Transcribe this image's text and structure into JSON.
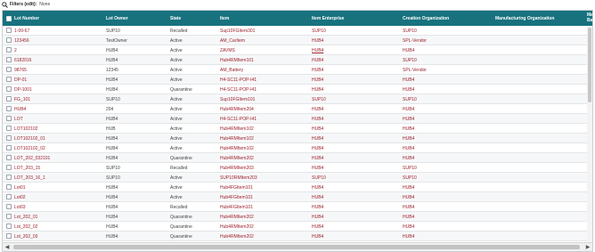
{
  "filters": {
    "label": "Filters (edit):",
    "value": "None"
  },
  "table": {
    "columns": [
      "Lot Number",
      "Lot Owner",
      "State",
      "Item",
      "Item Enterprise",
      "Creation Organization",
      "Manufacturing Organization",
      "Ma Ba"
    ],
    "rows": [
      [
        "1-09-67",
        "SUP10",
        "Recalled",
        "Sup10FGItem301",
        "SUP10",
        "SUP10"
      ],
      [
        "123456",
        "TestOwner",
        "Active",
        "AM_CarItem",
        "HUB4",
        "SPL-Vendor"
      ],
      [
        "2",
        "HUB4",
        "Active",
        "ZAVMS",
        "HUB4",
        "HUB4"
      ],
      [
        "6182016",
        "HUB4",
        "Active",
        "Hub4RMItem101",
        "HUB4",
        "SUP10"
      ],
      [
        "98765",
        "12345",
        "Active",
        "AM_Battery",
        "HUB4",
        "SPL-Vendor"
      ],
      [
        "DP-01",
        "HUB4",
        "Active",
        "H4-SC11-POP-I41",
        "HUB4",
        "HUB4"
      ],
      [
        "DP-1001",
        "HUB4",
        "Quarantine",
        "H4-SC11-POP-I41",
        "HUB4",
        "HUB4"
      ],
      [
        "FG_101",
        "SUP10",
        "Active",
        "Sup10FGItem101",
        "SUP10",
        "SUP10"
      ],
      [
        "HUB4",
        "204",
        "Active",
        "Hub4RMItem204",
        "HUB4",
        "HUB4"
      ],
      [
        "LOT",
        "HUB4",
        "Active",
        "H4-SC11-POP-I41",
        "HUB4",
        "HUB4"
      ],
      [
        "LOT102102",
        "HUB",
        "Active",
        "Hub4RMItem102",
        "HUB4",
        "HUB4"
      ],
      [
        "LOT102102_01",
        "HUB4",
        "Active",
        "Hub4RMItem102",
        "HUB4",
        "HUB4"
      ],
      [
        "LOT102102_02",
        "HUB4",
        "Active",
        "Hub4RMItem102",
        "HUB4",
        "HUB4"
      ],
      [
        "LOT_202_032101",
        "HUB4",
        "Quarantine",
        "Hub4RMItem202",
        "HUB4",
        "HUB4"
      ],
      [
        "LOT_203_15",
        "SUP10",
        "Recalled",
        "Hub4RMItem203",
        "HUB4",
        "SUP10"
      ],
      [
        "LOT_203_16_1",
        "SUP10",
        "Active",
        "SUP10RMItem203",
        "SUP10",
        "SUP10"
      ],
      [
        "Lot01",
        "HUB4",
        "Active",
        "Hub4FGItem101",
        "HUB4",
        "HUB4"
      ],
      [
        "Lot02",
        "HUB4",
        "Active",
        "Hub4FGItem101",
        "HUB4",
        "HUB4"
      ],
      [
        "Lot03",
        "HUB4",
        "Recalled",
        "Hub4FGItem101",
        "HUB4",
        "HUB4"
      ],
      [
        "Lot_202_01",
        "HUB4",
        "Quarantine",
        "Hub4RMItem202",
        "HUB4",
        "HUB4"
      ],
      [
        "Lot_202_02",
        "HUB4",
        "Quarantine",
        "Hub4RMItem202",
        "HUB4",
        "HUB4"
      ],
      [
        "Lot_202_03",
        "HUB4",
        "Quarantine",
        "Hub4RMItem202",
        "HUB4",
        "HUB4"
      ]
    ]
  },
  "colors": {
    "header": "#17727e",
    "link": "#9c1f2b"
  },
  "icons": {
    "filter": "search-icon",
    "scroll_left": "triangle-left",
    "scroll_right": "triangle-right"
  }
}
